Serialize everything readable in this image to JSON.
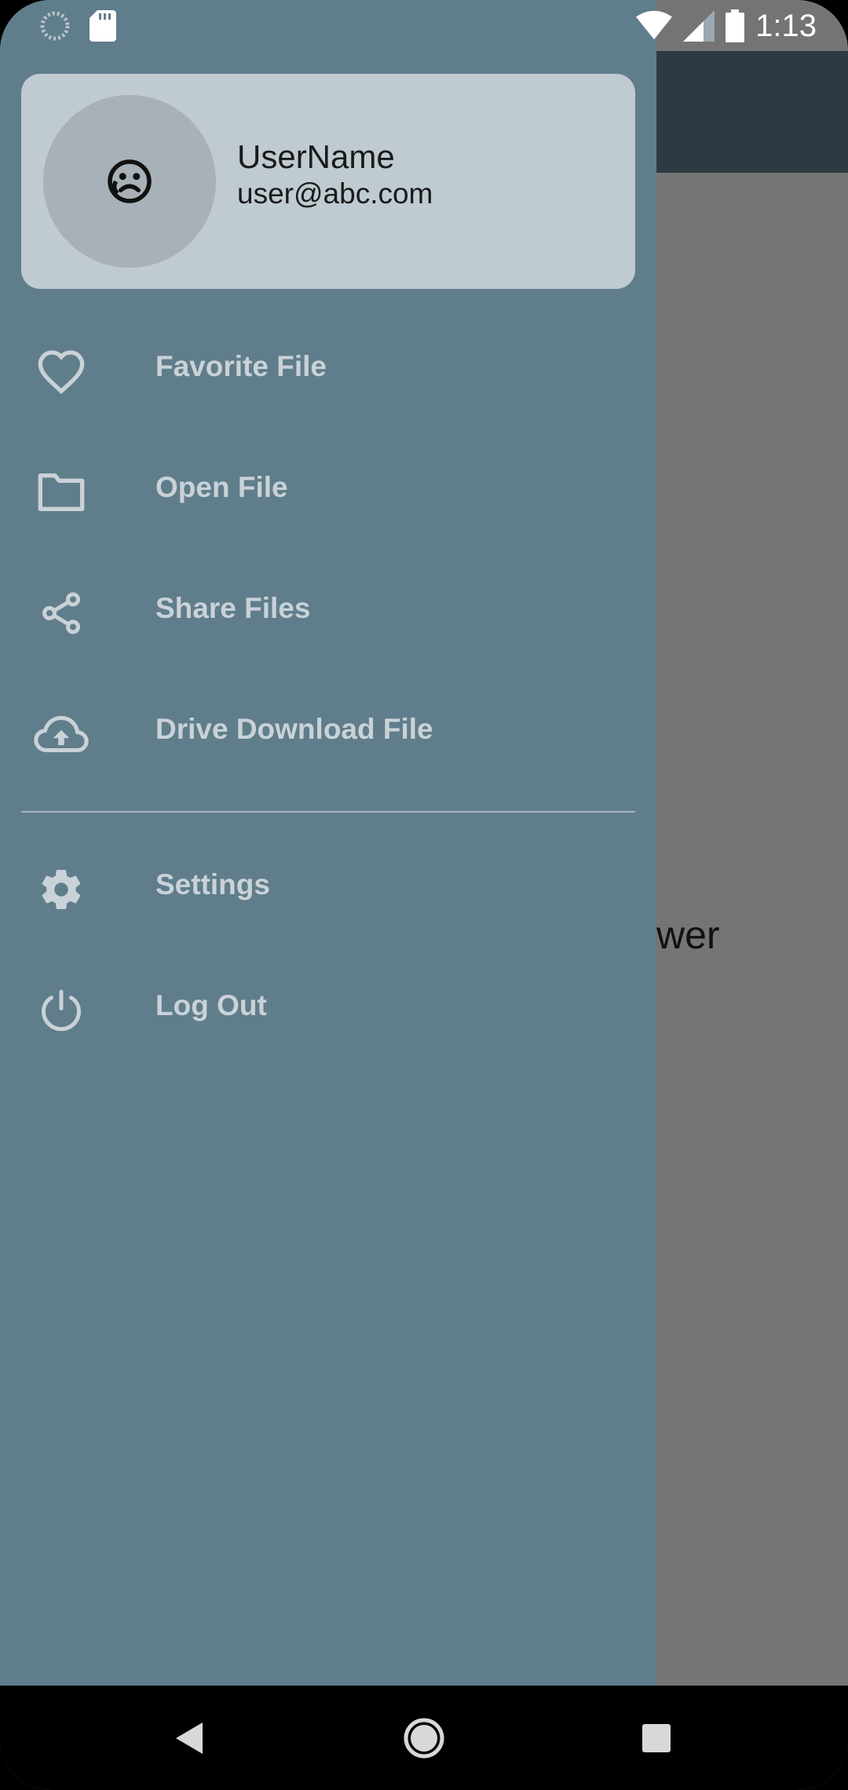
{
  "status_bar": {
    "time": "1:13",
    "left_icons": [
      "loading-icon",
      "sd-card-icon"
    ],
    "right_icons": [
      "wifi-icon",
      "cell-signal-icon",
      "battery-icon"
    ]
  },
  "background_app": {
    "partial_text": "wer"
  },
  "drawer": {
    "header": {
      "username": "UserName",
      "email": "user@abc.com",
      "avatar_icon": "sad-face-icon"
    },
    "items": [
      {
        "label": "Favorite File",
        "icon": "heart-icon"
      },
      {
        "label": "Open File",
        "icon": "folder-icon"
      },
      {
        "label": "Share Files",
        "icon": "share-icon"
      },
      {
        "label": "Drive Download File",
        "icon": "cloud-upload-icon"
      }
    ],
    "secondary_items": [
      {
        "label": "Settings",
        "icon": "gear-icon"
      },
      {
        "label": "Log Out",
        "icon": "power-icon"
      }
    ]
  },
  "nav_bar": {
    "buttons": [
      "back-icon",
      "home-icon",
      "recents-icon"
    ]
  },
  "colors": {
    "drawer_bg": "#607d8b",
    "header_card_bg": "#bfcad1",
    "appbar_bg": "#2d3a42",
    "scrim_bg": "#757575"
  }
}
